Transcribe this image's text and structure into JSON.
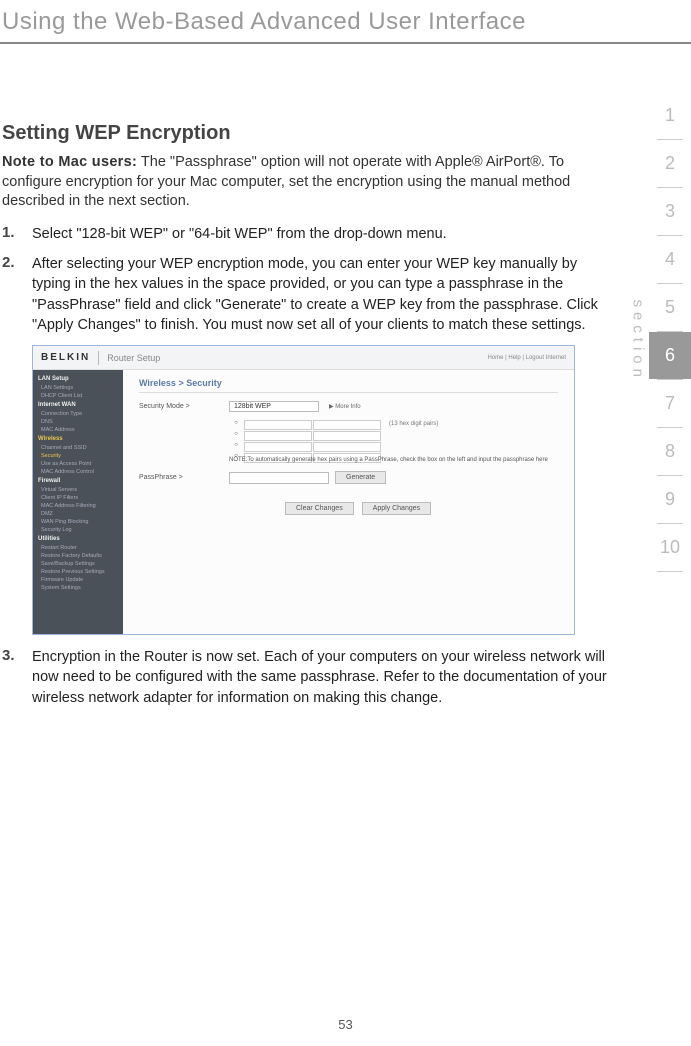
{
  "chapter_header": "Using the Web-Based Advanced User Interface",
  "section_label": "section",
  "side_nav": {
    "items": [
      "1",
      "2",
      "3",
      "4",
      "5",
      "6",
      "7",
      "8",
      "9",
      "10"
    ],
    "active_index": 5
  },
  "section_title": "Setting WEP Encryption",
  "note": {
    "label": "Note to Mac users:",
    "text": "The \"Passphrase\" option will not operate with Apple® AirPort®. To configure encryption for your Mac computer, set the encryption using the manual method described in the next section."
  },
  "list": [
    {
      "num": "1.",
      "text": "Select \"128-bit WEP\" or \"64-bit WEP\" from the drop-down menu."
    },
    {
      "num": "2.",
      "text": "After selecting your WEP encryption mode, you can enter your WEP key manually by typing in the hex values in the space provided, or you can type a passphrase in the \"PassPhrase\" field and click \"Generate\" to create a WEP key from the passphrase. Click \"Apply Changes\" to finish. You must now set all of your clients to match these settings."
    },
    {
      "num": "3.",
      "text": "Encryption in the Router is now set. Each of your computers on your wireless network will now need to be configured with the same passphrase. Refer to the documentation of your wireless network adapter for information on making this change."
    }
  ],
  "screenshot": {
    "brand": "BELKIN",
    "app_title": "Router Setup",
    "top_links": "Home | Help | Logout   Internet",
    "sidebar": {
      "groups": [
        {
          "header": "LAN Setup",
          "items": [
            "LAN Settings",
            "DHCP Client List"
          ]
        },
        {
          "header": "Internet WAN",
          "items": [
            "Connection Type",
            "DNS",
            "MAC Address"
          ]
        },
        {
          "header": "Wireless",
          "items": [
            "Channel and SSID",
            "Security",
            "Use as Access Point",
            "MAC Address Control"
          ],
          "highlight": true
        },
        {
          "header": "Firewall",
          "items": [
            "Virtual Servers",
            "Client IP Filters",
            "MAC Address Filtering",
            "DMZ",
            "WAN Ping Blocking",
            "Security Log"
          ]
        },
        {
          "header": "Utilities",
          "items": [
            "Restart Router",
            "Restore Factory Defaults",
            "Save/Backup Settings",
            "Restore Previous Settings",
            "Firmware Update",
            "System Settings"
          ]
        }
      ]
    },
    "breadcrumb": "Wireless > Security",
    "security_mode_label": "Security Mode >",
    "security_mode_value": "128bit WEP",
    "more_info": "▶ More Info",
    "hex_note": "(13 hex digit pairs)",
    "help_text": "NOTE:To automatically generate hex pairs using a PassPhrase, check the box on the left and input the passphrase here",
    "passphrase_label": "PassPhrase >",
    "buttons": {
      "generate": "Generate",
      "clear": "Clear Changes",
      "apply": "Apply Changes"
    }
  },
  "page_number": "53"
}
